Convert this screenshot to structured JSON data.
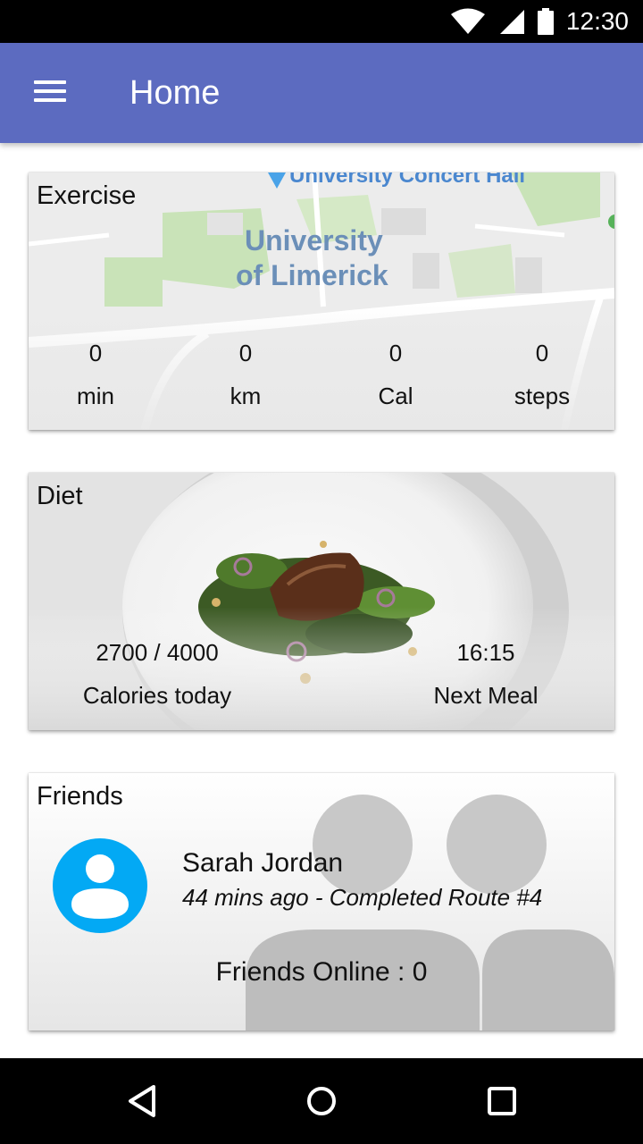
{
  "status_bar": {
    "time": "12:30",
    "icons": [
      "wifi-icon",
      "signal-icon",
      "battery-icon"
    ]
  },
  "app_bar": {
    "title": "Home",
    "menu_icon": "hamburger-menu-icon",
    "color": "#5C6BC0"
  },
  "exercise_card": {
    "title": "Exercise",
    "map_labels": {
      "venue": "University Concert Hall",
      "campus_line1": "University",
      "campus_line2": "of Limerick"
    },
    "stats": [
      {
        "value": "0",
        "label": "min"
      },
      {
        "value": "0",
        "label": "km"
      },
      {
        "value": "0",
        "label": "Cal"
      },
      {
        "value": "0",
        "label": "steps"
      }
    ]
  },
  "diet_card": {
    "title": "Diet",
    "calories": {
      "value": "2700 / 4000",
      "label": "Calories today"
    },
    "next_meal": {
      "value": "16:15",
      "label": "Next Meal"
    }
  },
  "friends_card": {
    "title": "Friends",
    "friend": {
      "name": "Sarah Jordan",
      "status": "44 mins ago - Completed Route #4",
      "avatar_color": "#03A9F4"
    },
    "online": "Friends Online : 0"
  },
  "nav_bar": {
    "buttons": [
      "back-icon",
      "home-icon",
      "recents-icon"
    ]
  }
}
